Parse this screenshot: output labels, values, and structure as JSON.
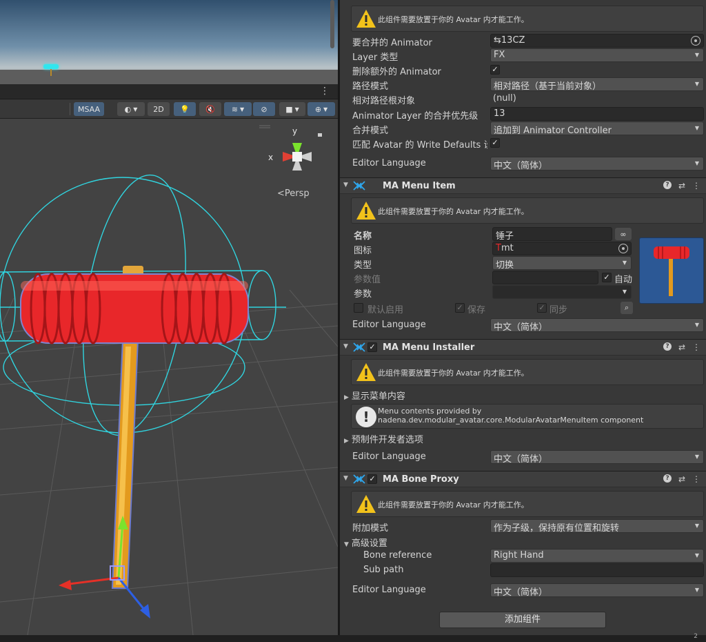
{
  "scene": {
    "toolbar": {
      "msaa_label": "MSAA",
      "mode_2d_label": "2D"
    },
    "gizmo": {
      "axis_y": "y",
      "axis_x": "x"
    },
    "persp_label": "Persp"
  },
  "inspector": {
    "merge_animator": {
      "warning_text": "此组件需要放置于你的 Avatar 内才能工作。",
      "fields": {
        "animator_label": "要合并的 Animator",
        "animator_value": "13CZ",
        "layer_type_label": "Layer 类型",
        "layer_type_value": "FX",
        "delete_extra_label": "删除额外的 Animator",
        "delete_extra_checked": true,
        "path_mode_label": "路径模式",
        "path_mode_value": "相对路径（基于当前对象）",
        "relative_root_label": "相对路径根对象",
        "relative_root_value": "(null)",
        "layer_priority_label": "Animator Layer 的合并优先级",
        "layer_priority_value": "13",
        "merge_mode_label": "合并模式",
        "merge_mode_value": "追加到 Animator Controller",
        "write_defaults_label": "匹配 Avatar 的 Write Defaults 设置",
        "write_defaults_checked": true,
        "editor_language_label": "Editor Language",
        "editor_language_value": "中文（简体）"
      }
    },
    "menu_item": {
      "title": "MA Menu Item",
      "warning_text": "此组件需要放置于你的 Avatar 内才能工作。",
      "name_label": "名称",
      "name_value": "锤子",
      "icon_label": "图标",
      "icon_value": "mt",
      "type_label": "类型",
      "type_value": "切换",
      "param_value_label": "参数值",
      "auto_label": "自动",
      "param_label": "参数",
      "default_on_label": "默认启用",
      "saved_label": "保存",
      "synced_label": "同步",
      "editor_language_label": "Editor Language",
      "editor_language_value": "中文（简体）"
    },
    "menu_installer": {
      "title": "MA Menu Installer",
      "warning_text": "此组件需要放置于你的 Avatar 内才能工作。",
      "show_menu_label": "显示菜单内容",
      "info_text": "Menu contents provided by nadena.dev.modular_avatar.core.ModularAvatarMenuItem component",
      "prefab_dev_label": "预制件开发者选项",
      "editor_language_label": "Editor Language",
      "editor_language_value": "中文（简体）"
    },
    "bone_proxy": {
      "title": "MA Bone Proxy",
      "warning_text": "此组件需要放置于你的 Avatar 内才能工作。",
      "attach_mode_label": "附加模式",
      "attach_mode_value": "作为子级，保持原有位置和旋转",
      "advanced_label": "高级设置",
      "bone_ref_label": "Bone reference",
      "bone_ref_value": "Right Hand",
      "sub_path_label": "Sub path",
      "sub_path_value": "",
      "editor_language_label": "Editor Language",
      "editor_language_value": "中文（简体）"
    },
    "add_component_label": "添加组件"
  },
  "status_bar": {
    "counter": "2"
  },
  "colors": {
    "inspector_bg": "#383838",
    "accent_blue": "#46607c",
    "hammer_head": "#e8272a",
    "hammer_handle": "#e39a1e",
    "collider_cyan": "#30d5e0",
    "warning_yellow": "#f2c21b"
  }
}
